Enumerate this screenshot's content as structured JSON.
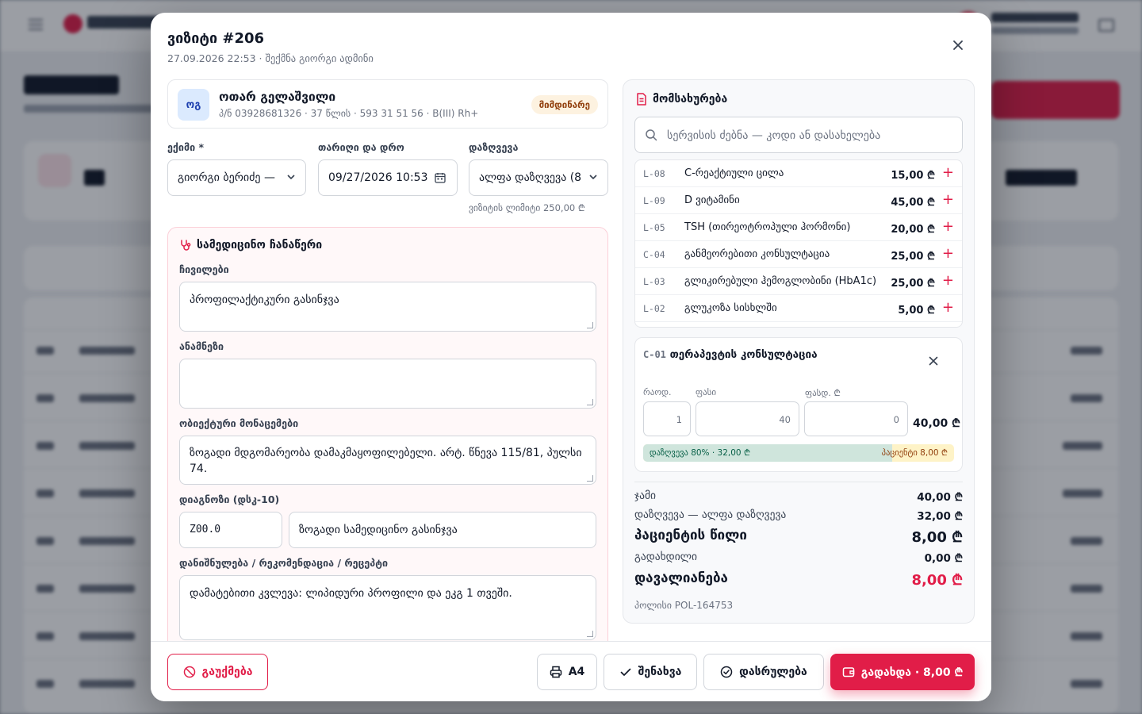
{
  "visit": {
    "title": "ვიზიტი #206",
    "subtitle": "27.09.2026 22:53 · შექმნა გიორგი ადმინი"
  },
  "patient": {
    "initials": "ოგ",
    "name": "ოთარ გელაშვილი",
    "meta": "პ/ნ 03928681326 · 37 წლის · 593 31 51 56 · B(III) Rh+",
    "status": "მიმდინარე"
  },
  "form": {
    "doctor_label": "ექიმი *",
    "doctor_value": "გიორგი ბერიძე —",
    "datetime_label": "თარიღი და დრო",
    "datetime_value": "09/27/2026 10:53",
    "insurance_label": "დაზღვევა",
    "insurance_value": "ალფა დაზღვევა (8",
    "visit_limit": "ვიზიტის ლიმიტი 250,00 ₾"
  },
  "medical": {
    "title": "სამედიცინო ჩანაწერი",
    "complaints_label": "ჩივილები",
    "complaints_value": "პროფილაქტიკური გასინჯვა",
    "anamnesis_label": "ანამნეზი",
    "anamnesis_value": "",
    "objective_label": "ობიექტური მონაცემები",
    "objective_value": "ზოგადი მდგომარეობა დამაკმაყოფილებელი. არტ. წნევა 115/81, პულსი 74.",
    "diagnosis_label": "დიაგნოზი (დსკ-10)",
    "diagnosis_code": "Z00.0",
    "diagnosis_text": "ზოგადი სამედიცინო გასინჯვა",
    "plan_label": "დანიშნულება / რეკომენდაცია / რეცეპტი",
    "plan_value": "დამატებითი კვლევა: ლიპიდური პროფილი და ეკგ 1 თვეში."
  },
  "services": {
    "title": "მომსახურება",
    "search_placeholder": "სერვისის ძებნა — კოდი ან დასახელება",
    "items": [
      {
        "code": "L-08",
        "name": "C-რეაქტიული ცილა",
        "price": "15,00 ₾"
      },
      {
        "code": "L-09",
        "name": "D ვიტამინი",
        "price": "45,00 ₾"
      },
      {
        "code": "L-05",
        "name": "TSH (თირეოტროპული ჰორმონი)",
        "price": "20,00 ₾"
      },
      {
        "code": "C-04",
        "name": "განმეორებითი კონსულტაცია",
        "price": "25,00 ₾"
      },
      {
        "code": "L-03",
        "name": "გლიკირებული ჰემოგლობინი (HbA1c)",
        "price": "25,00 ₾"
      },
      {
        "code": "L-02",
        "name": "გლუკოზა სისხლში",
        "price": "5,00 ₾"
      }
    ],
    "selected": {
      "code": "C-01",
      "name": "თერაპევტის კონსულტაცია",
      "qty_label": "რაოდ.",
      "qty": "1",
      "price_label": "ფასი",
      "price": "40",
      "discount_label": "ფასდ. ₾",
      "discount": "0",
      "total": "40,00 ₾",
      "insurance_share": 0.8,
      "insurance_text": "დაზღვევა 80% · 32,00 ₾",
      "patient_text": "პაციენტი 8,00 ₾"
    },
    "summary": {
      "total_label": "ჯამი",
      "total": "40,00 ₾",
      "insurance_label": "დაზღვევა — ალფა დაზღვევა",
      "insurance": "32,00 ₾",
      "patient_label": "პაციენტის წილი",
      "patient": "8,00 ₾",
      "paid_label": "გადახდილი",
      "paid": "0,00 ₾",
      "debt_label": "დავალიანება",
      "debt": "8,00 ₾",
      "policy": "პოლისი POL-164753"
    }
  },
  "footer": {
    "cancel": "გაუქმება",
    "print": "A4",
    "save": "შენახვა",
    "complete": "დასრულება",
    "pay": "გადახდა · 8,00 ₾"
  },
  "colors": {
    "accent": "#e11d48",
    "insurance_fill": "#cfe5dc",
    "patient_fill": "#fef3c7"
  }
}
